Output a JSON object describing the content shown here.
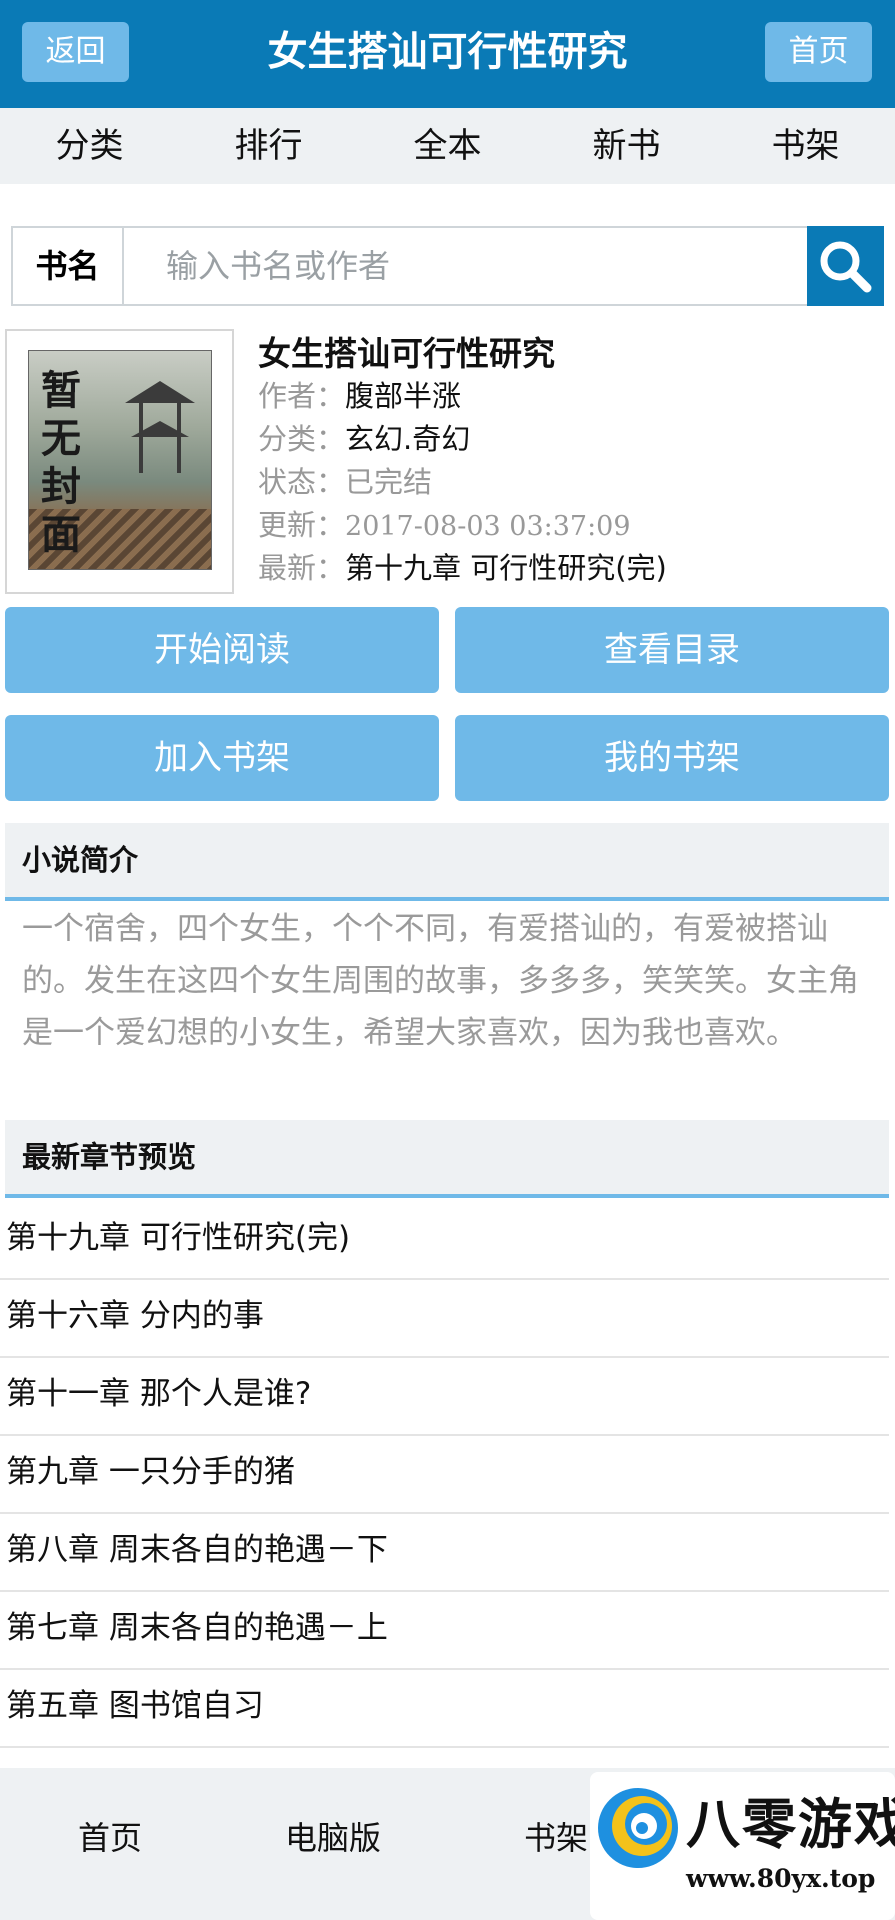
{
  "header": {
    "back_label": "返回",
    "title": "女生搭讪可行性研究",
    "home_label": "首页"
  },
  "nav": {
    "items": [
      {
        "label": "分类"
      },
      {
        "label": "排行"
      },
      {
        "label": "全本"
      },
      {
        "label": "新书"
      },
      {
        "label": "书架"
      }
    ]
  },
  "search": {
    "label": "书名",
    "placeholder": "输入书名或作者",
    "value": ""
  },
  "book": {
    "cover_text": "暂无封面",
    "title": "女生搭讪可行性研究",
    "author_label": "作者：",
    "author": "腹部半涨",
    "category_label": "分类：",
    "category": "玄幻.奇幻",
    "status_label": "状态：",
    "status": "已完结",
    "updated_label": "更新：",
    "updated": "2017-08-03 03:37:09",
    "latest_label": "最新：",
    "latest": "第十九章 可行性研究(完)"
  },
  "actions": {
    "start_reading": "开始阅读",
    "view_toc": "查看目录",
    "add_shelf": "加入书架",
    "my_shelf": "我的书架"
  },
  "intro": {
    "heading": "小说简介",
    "text": "一个宿舍，四个女生，个个不同，有爱搭讪的，有爱被搭讪的。发生在这四个女生周围的故事，多多多，笑笑笑。女主角是一个爱幻想的小女生，希望大家喜欢，因为我也喜欢。"
  },
  "latest_chapters": {
    "heading": "最新章节预览",
    "items": [
      {
        "title": "第十九章 可行性研究(完)"
      },
      {
        "title": "第十六章 分内的事"
      },
      {
        "title": "第十一章 那个人是谁?"
      },
      {
        "title": "第九章 一只分手的猪"
      },
      {
        "title": "第八章 周末各自的艳遇－下"
      },
      {
        "title": "第七章 周末各自的艳遇－上"
      },
      {
        "title": "第五章 图书馆自习"
      }
    ]
  },
  "footer": {
    "items": [
      {
        "label": "首页"
      },
      {
        "label": "电脑版"
      },
      {
        "label": "书架"
      }
    ]
  },
  "watermark": {
    "title": "八零游戏",
    "url": "www.80yx.top"
  },
  "colors": {
    "primary": "#0a7ab6",
    "button": "#6fb9e8",
    "light_bg": "#eef1f3"
  },
  "icons": {
    "search": "search-icon",
    "logo": "swirl-logo-icon"
  }
}
